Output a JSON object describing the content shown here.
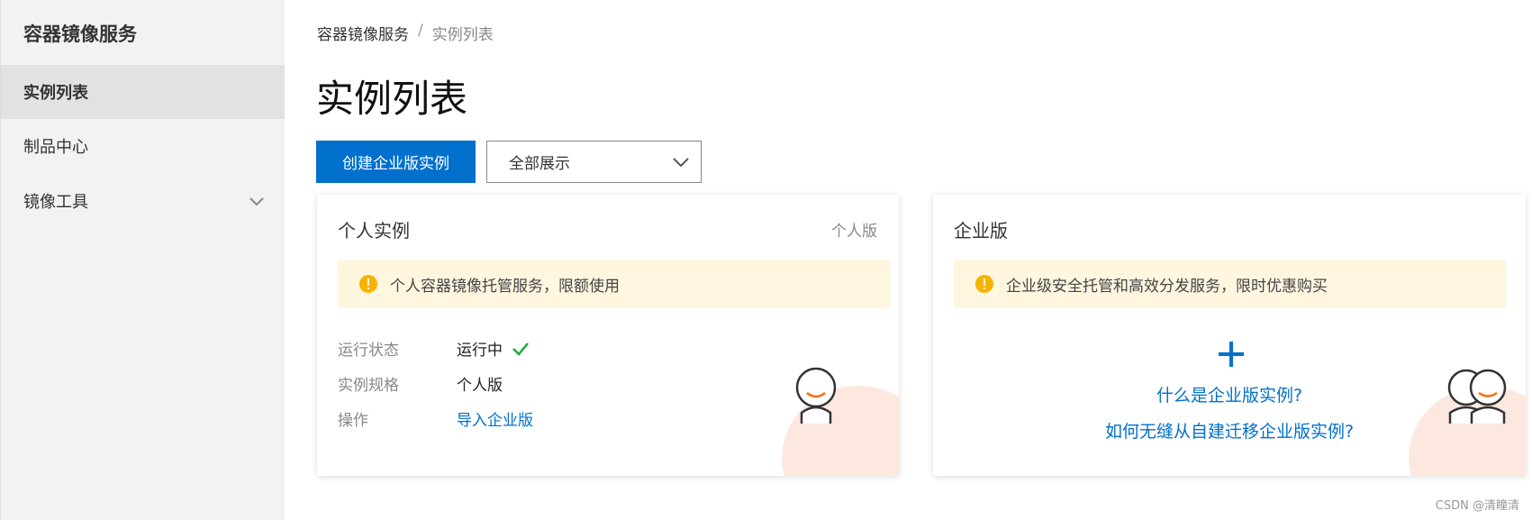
{
  "sidebar": {
    "title": "容器镜像服务",
    "items": [
      {
        "label": "实例列表"
      },
      {
        "label": "制品中心"
      },
      {
        "label": "镜像工具"
      }
    ]
  },
  "breadcrumb": {
    "root": "容器镜像服务",
    "separator": "/",
    "current": "实例列表"
  },
  "page": {
    "title": "实例列表"
  },
  "toolbar": {
    "create_label": "创建企业版实例",
    "filter_value": "全部展示"
  },
  "personal_card": {
    "title": "个人实例",
    "tag": "个人版",
    "notice": "个人容器镜像托管服务，限额使用",
    "rows": [
      {
        "label": "运行状态",
        "value": "运行中"
      },
      {
        "label": "实例规格",
        "value": "个人版"
      },
      {
        "label": "操作",
        "value": "导入企业版"
      }
    ]
  },
  "enterprise_card": {
    "title": "企业版",
    "notice": "企业级安全托管和高效分发服务，限时优惠购买",
    "link1": "什么是企业版实例?",
    "link2": "如何无缝从自建迁移企业版实例?"
  },
  "watermark": "CSDN @清瞳清",
  "colors": {
    "accent": "#0070cc",
    "warning": "#f5b400",
    "success": "#1aab3a",
    "notice_bg": "#fff6df",
    "avatar_smile": "#ff6a00"
  }
}
